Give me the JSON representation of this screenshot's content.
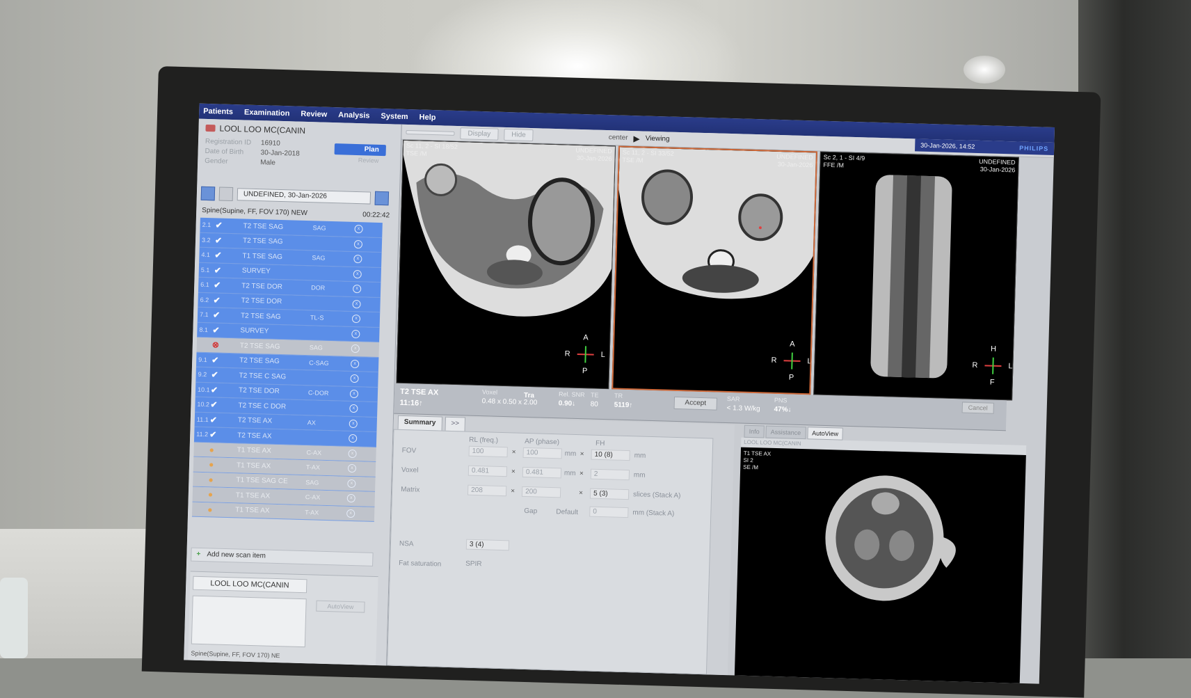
{
  "menu": [
    "Patients",
    "Examination",
    "Review",
    "Analysis",
    "System",
    "Help"
  ],
  "toolbar": {
    "display": "Display",
    "hide": "Hide",
    "center": "center",
    "play": "▶",
    "viewing": "Viewing"
  },
  "datebar": {
    "date": "30-Jan-2026, 14:52",
    "brand": "PHILIPS"
  },
  "patient": {
    "name": "LOOL LOO  MC(CANIN",
    "registration_label": "Registration ID",
    "registration_value": "16910",
    "dob_label": "Date of Birth",
    "dob_value": "30-Jan-2018",
    "gender_label": "Gender",
    "gender_value": "Male"
  },
  "actions": {
    "plan": "Plan",
    "review": "Review"
  },
  "exam": {
    "selector": "UNDEFINED, 30-Jan-2026",
    "title": "Spine(Supine, FF, FOV 170) NEW",
    "timer": "00:22:42"
  },
  "scans": [
    {
      "num": "2.1",
      "status": "check",
      "name": "T2 TSE SAG",
      "ori": "SAG",
      "style": "blue"
    },
    {
      "num": "3.2",
      "status": "check",
      "name": "T2 TSE SAG",
      "ori": "",
      "style": "blue"
    },
    {
      "num": "4.1",
      "status": "check",
      "name": "T1 TSE SAG",
      "ori": "SAG",
      "style": "blue"
    },
    {
      "num": "5.1",
      "status": "check",
      "name": "SURVEY",
      "ori": "",
      "style": "blue"
    },
    {
      "num": "6.1",
      "status": "check",
      "name": "T2 TSE DOR",
      "ori": "DOR",
      "style": "blue"
    },
    {
      "num": "6.2",
      "status": "check",
      "name": "T2 TSE DOR",
      "ori": "",
      "style": "blue"
    },
    {
      "num": "7.1",
      "status": "check",
      "name": "T2 TSE SAG",
      "ori": "TL-S",
      "style": "blue"
    },
    {
      "num": "8.1",
      "status": "check",
      "name": "SURVEY",
      "ori": "",
      "style": "blue"
    },
    {
      "num": "",
      "status": "error",
      "name": "T2 TSE SAG",
      "ori": "SAG",
      "style": "gray"
    },
    {
      "num": "9.1",
      "status": "check",
      "name": "T2 TSE SAG",
      "ori": "C-SAG",
      "style": "blue"
    },
    {
      "num": "9.2",
      "status": "check",
      "name": "T2 TSE C SAG",
      "ori": "",
      "style": "blue"
    },
    {
      "num": "10.1",
      "status": "check",
      "name": "T2 TSE DOR",
      "ori": "C-DOR",
      "style": "blue"
    },
    {
      "num": "10.2",
      "status": "check",
      "name": "T2 TSE C DOR",
      "ori": "",
      "style": "blue"
    },
    {
      "num": "11.1",
      "status": "check",
      "name": "T2 TSE AX",
      "ori": "AX",
      "style": "blue"
    },
    {
      "num": "11.2",
      "status": "check",
      "name": "T2 TSE AX",
      "ori": "",
      "style": "blue"
    },
    {
      "num": "",
      "status": "warn",
      "name": "T1 TSE AX",
      "ori": "C-AX",
      "style": "gray"
    },
    {
      "num": "",
      "status": "warn",
      "name": "T1 TSE AX",
      "ori": "T-AX",
      "style": "gray"
    },
    {
      "num": "",
      "status": "warn",
      "name": "T1 TSE SAG CE",
      "ori": "SAG",
      "style": "gray"
    },
    {
      "num": "",
      "status": "warn",
      "name": "T1 TSE AX",
      "ori": "C-AX",
      "style": "gray"
    },
    {
      "num": "",
      "status": "warn",
      "name": "T1 TSE AX",
      "ori": "T-AX",
      "style": "gray"
    }
  ],
  "add_scan": "Add new scan item",
  "bottom": {
    "name": "LOOL LOO  MC(CANIN",
    "autoview": "AutoView",
    "foot": "Spine(Supine, FF, FOV 170) NE"
  },
  "viewports": [
    {
      "tl1": "Sc 11, 2 - SI 18/52",
      "tl2": "TSE  /M",
      "tr1": "UNDEFINED",
      "tr2": "30-Jan-2026",
      "a": "A",
      "r": "R",
      "l": "L",
      "p": "P"
    },
    {
      "tl1": "Sc 11, 2 - SI 33/52",
      "tl2": "TSE  /M",
      "tr1": "UNDEFINED",
      "tr2": "30-Jan-2026",
      "a": "A",
      "r": "R",
      "l": "L",
      "p": "P"
    },
    {
      "tl1": "Sc 2, 1 - SI 4/9",
      "tl2": "FFE  /M",
      "tr1": "UNDEFINED",
      "tr2": "30-Jan-2026",
      "a": "H",
      "r": "R",
      "l": "L",
      "p": "F"
    }
  ],
  "params": {
    "seq": "T2 TSE AX",
    "time": "11:16↑",
    "voxel_label": "Voxel",
    "voxel_value": "0.48 x 0.50 x 2.00",
    "tra_label": "Tra",
    "snr_label": "Rel. SNR",
    "snr_value": "0.90↓",
    "te_label": "TE",
    "te_value": "80",
    "tr_label": "TR",
    "tr_value": "5119↑",
    "accept": "Accept",
    "sar_label": "SAR",
    "sar_value": "< 1.3  W/kg",
    "pns_label": "PNS",
    "pns_value": "47%↓",
    "cancel": "Cancel"
  },
  "summary": {
    "tab": "Summary",
    "more": ">>",
    "rl": "RL (freq.)",
    "ap": "AP (phase)",
    "fh": "FH",
    "fov_label": "FOV",
    "fov_rl": "100",
    "fov_ap": "100",
    "fov_fh": "10 (8)",
    "mm": "mm",
    "x": "×",
    "voxel_label": "Voxel",
    "voxel_rl": "0.481",
    "voxel_ap": "0.481",
    "voxel_fh": "2",
    "matrix_label": "Matrix",
    "matrix_rl": "208",
    "matrix_ap": "200",
    "matrix_fh": "5 (3)",
    "slices": "slices (Stack A)",
    "gap_label": "Gap",
    "default": "Default",
    "gap_value": "0",
    "gap_unit": "mm (Stack A)",
    "nsa_label": "NSA",
    "nsa_value": "3 (4)",
    "fat_label": "Fat saturation",
    "fat_value": "SPIR"
  },
  "autoview": {
    "tabs": [
      "Info",
      "Assistance",
      "AutoView"
    ],
    "patient": "LOOL LOO  MC(CANIN",
    "l1": "T1 TSE AX",
    "l2": "SI 2",
    "l3": "SE  /M"
  }
}
